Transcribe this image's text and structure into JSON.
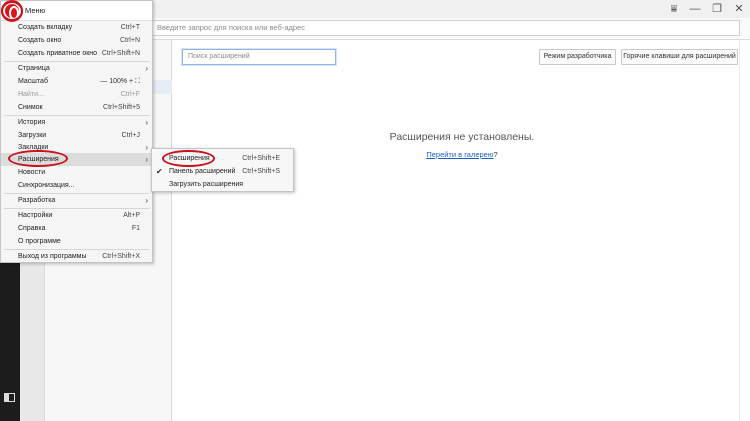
{
  "address_bar": {
    "placeholder": "Введите запрос для поиска или веб-адрес"
  },
  "window_controls": {
    "filter_glyph": "⩸",
    "minimize_glyph": "—",
    "restore_glyph": "❐",
    "close_glyph": "✕"
  },
  "extensions_page": {
    "search_placeholder": "Поиск расширений",
    "dev_mode_button": "Режим разработчика",
    "hotkeys_button": "Горячие клавиши для расширений",
    "empty_message": "Расширения не установлены.",
    "gallery_link": "Перейти в галерею",
    "gallery_suffix": "?"
  },
  "menu": {
    "title": "Меню",
    "items": [
      {
        "label": "Создать вкладку",
        "shortcut": "Ctrl+T"
      },
      {
        "label": "Создать окно",
        "shortcut": "Ctrl+N"
      },
      {
        "label": "Создать приватное окно",
        "shortcut": "Ctrl+Shift+N"
      },
      {
        "label": "Страница",
        "shortcut": ""
      },
      {
        "label": "Масштаб",
        "shortcut": ""
      },
      {
        "label": "Найти...",
        "shortcut": "Ctrl+F"
      },
      {
        "label": "Снимок",
        "shortcut": "Ctrl+Shift+5"
      },
      {
        "label": "История",
        "shortcut": ""
      },
      {
        "label": "Загрузки",
        "shortcut": "Ctrl+J"
      },
      {
        "label": "Закладки",
        "shortcut": ""
      },
      {
        "label": "Расширения",
        "shortcut": ""
      },
      {
        "label": "Новости",
        "shortcut": ""
      },
      {
        "label": "Синхронизация...",
        "shortcut": ""
      },
      {
        "label": "Разработка",
        "shortcut": ""
      },
      {
        "label": "Настройки",
        "shortcut": "Alt+P"
      },
      {
        "label": "Справка",
        "shortcut": "F1"
      },
      {
        "label": "О программе",
        "shortcut": ""
      },
      {
        "label": "Выход из программы",
        "shortcut": "Ctrl+Shift+X"
      }
    ],
    "zoom": {
      "minus": "—",
      "value": "100%",
      "plus": "+",
      "fullscreen": "⛶"
    },
    "arrow": "›"
  },
  "submenu": {
    "items": [
      {
        "label": "Расширения",
        "shortcut": "Ctrl+Shift+E"
      },
      {
        "label": "Панель расширений",
        "shortcut": "Ctrl+Shift+S",
        "checked": true
      },
      {
        "label": "Загрузить расширения",
        "shortcut": ""
      }
    ],
    "check_glyph": "✔"
  },
  "colors": {
    "accent_red": "#c8121c",
    "link_blue": "#1a5fc8"
  }
}
